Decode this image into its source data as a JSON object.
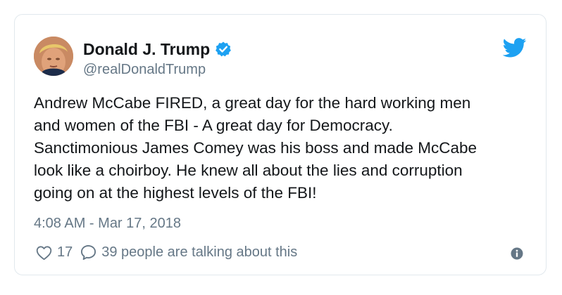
{
  "author": {
    "name": "Donald J. Trump",
    "handle": "@realDonaldTrump"
  },
  "tweet": {
    "lines": [
      "Andrew McCabe FIRED, a great day for the hard working men",
      "and women of the FBI - A great day for Democracy.",
      "Sanctimonious James Comey was his boss and made McCabe",
      "look like a choirboy. He knew all about the lies and corruption",
      "going on at the highest levels of the FBI!"
    ],
    "timestamp": "4:08 AM - Mar 17, 2018"
  },
  "actions": {
    "likes": "17",
    "talking": "39 people are talking about this"
  },
  "colors": {
    "twitter_blue": "#1da1f2",
    "secondary_text": "#657786",
    "primary_text": "#14171a",
    "border": "#e1e8ed"
  },
  "icons": {
    "verified": "verified-badge-icon",
    "brand": "twitter-bird-icon",
    "like": "heart-outline-icon",
    "reply": "speech-bubble-icon",
    "info": "info-circle-icon"
  }
}
